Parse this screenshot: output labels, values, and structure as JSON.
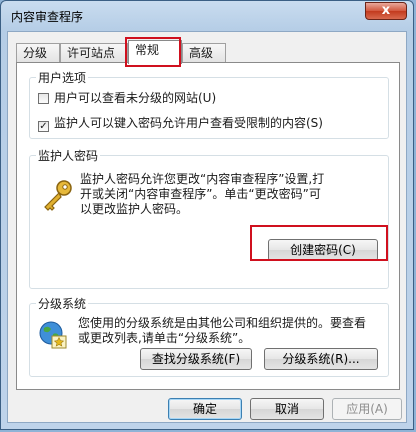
{
  "window": {
    "title": "内容审查程序",
    "close_glyph": "x"
  },
  "tabs": [
    {
      "label": "分级",
      "active": false
    },
    {
      "label": "许可站点",
      "active": false
    },
    {
      "label": "常规",
      "active": true
    },
    {
      "label": "高级",
      "active": false
    }
  ],
  "user_options": {
    "title": "用户选项",
    "options": [
      {
        "label": "用户可以查看未分级的网站(U)",
        "checked": false
      },
      {
        "label": "监护人可以键入密码允许用户查看受限制的内容(S)",
        "checked": true
      }
    ]
  },
  "supervisor": {
    "title": "监护人密码",
    "description_line1": "监护人密码允许您更改“内容审查程序”设置,打",
    "description_line2": "开或关闭“内容审查程序”。单击“更改密码”可",
    "description_line3": "以更改监护人密码。",
    "create_password_label": "创建密码(C)",
    "icon": "key-icon"
  },
  "rating_systems": {
    "title": "分级系统",
    "description_line1": "您使用的分级系统是由其他公司和组织提供的。要查看",
    "description_line2": "或更改列表,请单击“分级系统”。",
    "find_label": "查找分级系统(F)",
    "systems_label": "分级系统(R)...",
    "icon": "globe-certificate-icon"
  },
  "footer": {
    "ok_label": "确定",
    "cancel_label": "取消",
    "apply_label": "应用(A)"
  },
  "colors": {
    "highlight": "#d0101e",
    "accent": "#3c7fb1"
  }
}
